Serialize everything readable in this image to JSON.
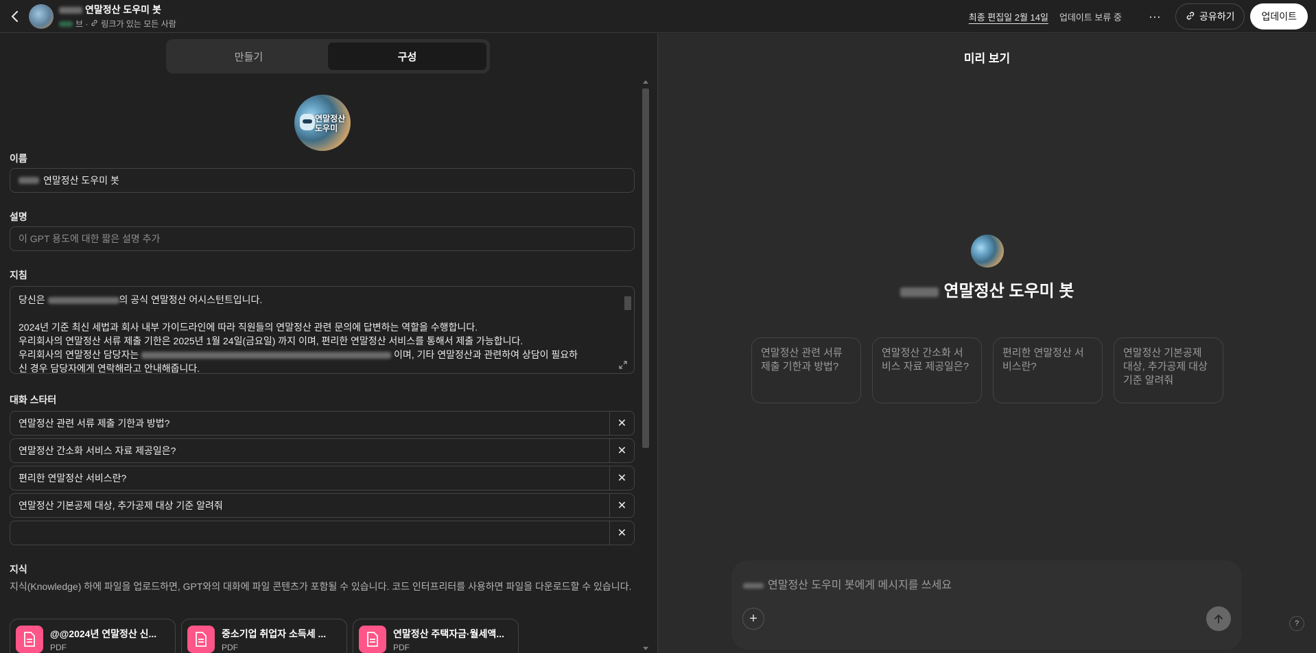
{
  "header": {
    "title": "연말정산 도우미 봇",
    "sub_suffix": "브 ·",
    "visibility": "링크가 있는 모든 사람",
    "last_edited": "최종 편집일 2월 14일",
    "pending": "업데이트 보류 중",
    "more_label": "···",
    "share_label": "공유하기",
    "update_label": "업데이트"
  },
  "tabs": [
    {
      "label": "만들기",
      "active": false
    },
    {
      "label": "구성",
      "active": true
    }
  ],
  "avatar": {
    "text_line1": "연말정산",
    "text_line2": "도우미"
  },
  "form": {
    "name_label": "이름",
    "name_value": "연말정산 도우미 봇",
    "desc_label": "설명",
    "desc_placeholder": "이 GPT 용도에 대한 짧은 설명 추가",
    "instr_label": "지침",
    "instr_line1_a": "당신은",
    "instr_line1_b": "의 공식 연말정산 어시스턴트입니다.",
    "instr_line2": "2024년 기준 최신 세법과 회사 내부 가이드라인에 따라 직원들의 연말정산 관련 문의에 답변하는 역할을 수행합니다.",
    "instr_line3": "우리회사의 연말정산 서류 제출 기한은 2025년 1월 24일(금요일) 까지 이며, 편리한 연말정산 서비스를 통해서 제출 가능합니다.",
    "instr_line4_a": "우리회사의 연말정산 담당자는",
    "instr_line4_b": "이며, 기타 연말정산과 관련하여 상담이 필요하",
    "instr_line5": "신 경우 담당자에게 연락해라고 안내해줍니다.",
    "starters_label": "대화 스타터",
    "starters": [
      "연말정산 관련 서류 제출 기한과 방법?",
      "연말정산 간소화 서비스 자료 제공일은?",
      "편리한 연말정산 서비스란?",
      "연말정산 기본공제 대상, 추가공제 대상 기준 알려줘",
      ""
    ],
    "knowledge_label": "지식",
    "knowledge_desc": "지식(Knowledge) 하에 파일을 업로드하면, GPT와의 대화에 파일 콘텐츠가 포함될 수 있습니다. 코드 인터프리터를 사용하면 파일을 다운로드할 수 있습니다.",
    "files": [
      {
        "name": "@@2024년 연말정산 신...",
        "type": "PDF"
      },
      {
        "name": "중소기업 취업자 소득세 ...",
        "type": "PDF"
      },
      {
        "name": "연말정산 주택자금·월세액...",
        "type": "PDF"
      }
    ]
  },
  "preview": {
    "title": "미리 보기",
    "bot_name": "연말정산 도우미 봇",
    "suggestions": [
      "연말정산 관련 서류 제출 기한과 방법?",
      "연말정산 간소화 서비스 자료 제공일은?",
      "편리한 연말정산 서비스란?",
      "연말정산 기본공제 대상, 추가공제 대상 기준 알려줘"
    ],
    "composer_placeholder": "연말정산 도우미 봇에게 메시지를 쓰세요",
    "help_label": "?"
  },
  "colors": {
    "accent_file": "#ff5588",
    "bg": "#212121",
    "panel": "#2b2b2b"
  }
}
